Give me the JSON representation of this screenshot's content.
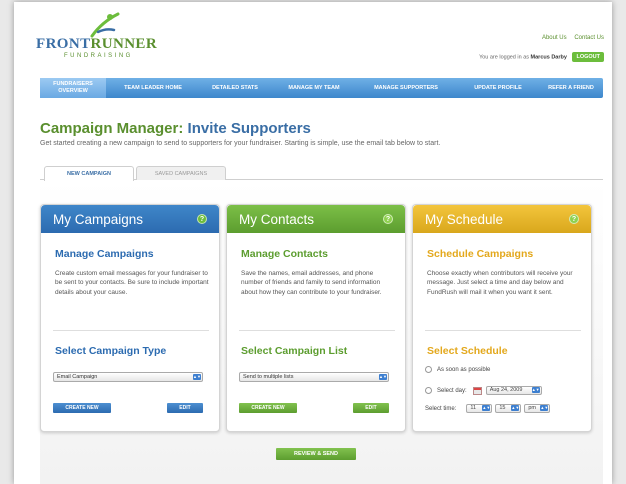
{
  "header": {
    "logo_main_a": "FRONT",
    "logo_main_b": "RUNNER",
    "logo_sub": "FUNDRAISING",
    "links": [
      "About Us",
      "Contact Us"
    ],
    "login_text": "You are logged in as",
    "user_name": "Marcus Darby",
    "logout_label": "LOGOUT"
  },
  "nav": {
    "items": [
      {
        "label": "FUNDRAISERS OVERVIEW"
      },
      {
        "label": "TEAM LEADER HOME"
      },
      {
        "label": "DETAILED STATS"
      },
      {
        "label": "MANAGE MY TEAM"
      },
      {
        "label": "MANAGE SUPPORTERS"
      },
      {
        "label": "UPDATE PROFILE"
      },
      {
        "label": "REFER A FRIEND"
      }
    ]
  },
  "page": {
    "title_a": "Campaign Manager:",
    "title_b": "Invite Supporters",
    "subtitle": "Get started creating a new campaign to send to supporters for your fundraiser. Starting is simple, use the email tab below to start."
  },
  "tabs": [
    {
      "label": "NEW CAMPAIGN"
    },
    {
      "label": "SAVED CAMPAIGNS"
    }
  ],
  "cards": {
    "campaigns": {
      "title": "My Campaigns",
      "section1": "Manage Campaigns",
      "desc": "Create custom email messages for your fundraiser to be sent to your contacts. Be sure to include important details about your cause.",
      "section2": "Select Campaign Type",
      "select_value": "Email Campaign",
      "btn_create": "CREATE NEW",
      "btn_edit": "EDIT"
    },
    "contacts": {
      "title": "My Contacts",
      "section1": "Manage Contacts",
      "desc": "Save the names, email addresses, and phone number of friends and family to send information about how they can contribute to your fundraiser.",
      "section2": "Select Campaign List",
      "select_value": "Send to multiple lists",
      "btn_create": "CREATE NEW",
      "btn_edit": "EDIT"
    },
    "schedule": {
      "title": "My Schedule",
      "section1": "Schedule Campaigns",
      "desc": "Choose exactly when contributors will receive your message. Just select a time and day below and FundRush will mail it when you want it sent.",
      "section2": "Select Schedule",
      "opt_asap": "As soon as possible",
      "opt_day": "Select day:",
      "date_value": "Aug 24, 2009",
      "time_label": "Select time:",
      "hour": "11",
      "minute": "15",
      "ampm": "pm"
    },
    "help_glyph": "?"
  },
  "review_label": "REVIEW & SEND"
}
